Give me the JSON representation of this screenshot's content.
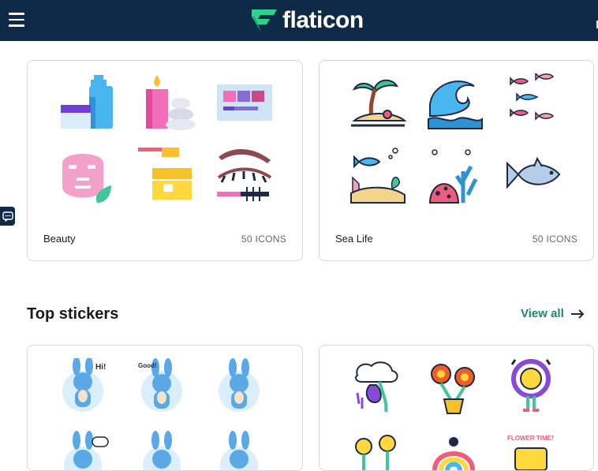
{
  "header": {
    "logo_text": "flaticon",
    "brand_color": "#0e2a47",
    "accent_color": "#2bd38f"
  },
  "collections": [
    {
      "title": "Beauty",
      "count": "50 ICONS",
      "icons": [
        "lotion-bottles-icon",
        "candle-stones-icon",
        "eyeshadow-palette-icon",
        "face-mask-icon",
        "cream-jar-icon",
        "eyelash-mascara-icon"
      ]
    },
    {
      "title": "Sea Life",
      "count": "50 ICONS",
      "icons": [
        "palm-island-icon",
        "ocean-wave-icon",
        "fish-school-icon",
        "fish-seaweed-icon",
        "coral-reef-icon",
        "tuna-fish-icon"
      ]
    }
  ],
  "stickers_section": {
    "title": "Top stickers",
    "view_all_label": "View all",
    "packs": [
      {
        "stickers": [
          "bunny-hi-sticker",
          "bunny-good-sticker",
          "bunny-happy-sticker",
          "bunny-chat-sticker",
          "bunny-surprised-sticker",
          "bunny-cheer-sticker"
        ]
      },
      {
        "stickers": [
          "flower-cloud-sticker",
          "flower-pot-sticker",
          "daisy-cheer-sticker",
          "daisy-duo-sticker",
          "rainbow-flower-sticker",
          "flower-time-sticker"
        ]
      }
    ]
  }
}
